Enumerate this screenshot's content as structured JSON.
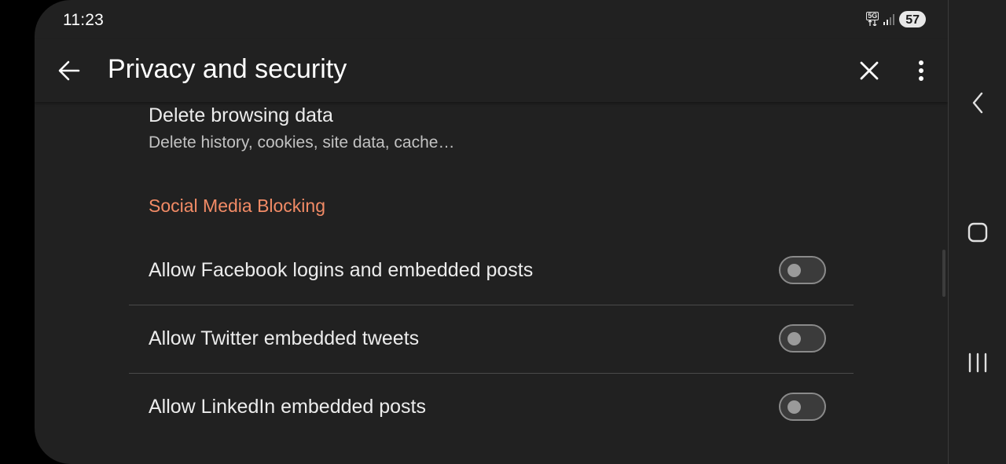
{
  "status_bar": {
    "time": "11:23",
    "network_label": "5G",
    "battery": "57",
    "icons": [
      "5g-icon",
      "signal-icon",
      "battery-icon"
    ]
  },
  "app_bar": {
    "title": "Privacy and security",
    "back_icon": "back-arrow-icon",
    "close_icon": "close-icon",
    "more_icon": "more-vert-icon"
  },
  "items": {
    "delete_browsing": {
      "title": "Delete browsing data",
      "subtitle": "Delete history, cookies, site data, cache…"
    }
  },
  "social_section": {
    "header": "Social Media Blocking",
    "toggles": [
      {
        "label": "Allow Facebook logins and embedded posts",
        "checked": false
      },
      {
        "label": "Allow Twitter embedded tweets",
        "checked": false
      },
      {
        "label": "Allow LinkedIn embedded posts",
        "checked": false
      }
    ]
  },
  "system_nav": {
    "icons": [
      "nav-back-icon",
      "nav-home-icon",
      "nav-recents-icon"
    ]
  },
  "colors": {
    "background": "#212121",
    "accent": "#f28b66",
    "text_primary": "#ececec",
    "text_secondary": "#c2c2c2"
  }
}
